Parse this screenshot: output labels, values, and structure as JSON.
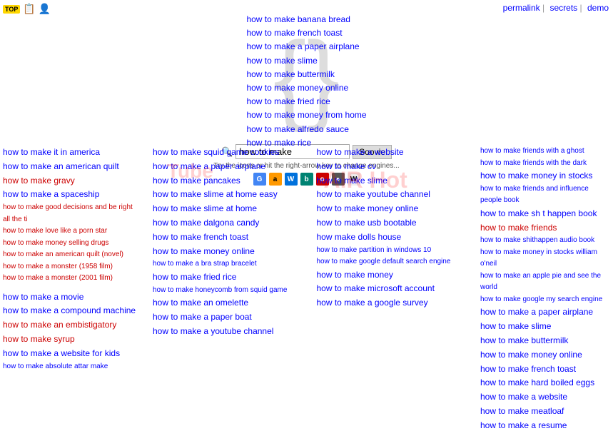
{
  "topbar": {
    "star_label": "TOP",
    "permalink": "permalink",
    "separator": "|",
    "secrets": "secrets",
    "demo": "demo"
  },
  "search": {
    "input_value": "how to make",
    "button_label": "Sooviе",
    "hint": "Try the icons or hit the right-arrow key to change engines...",
    "engines": [
      "G",
      "a",
      "W",
      "b",
      "o",
      "●",
      "W"
    ]
  },
  "center_links": [
    "how to make banana bread",
    "how to make french toast",
    "how to make a paper airplane",
    "how to make slime",
    "how to make buttermilk",
    "how to make money online",
    "how to make fried rice",
    "how to make money from home",
    "how to make alfredo sauce",
    "how to make rice"
  ],
  "col1": {
    "links": [
      {
        "text": "how to make it in america",
        "style": "blue"
      },
      {
        "text": "how to make an american quilt",
        "style": "blue"
      },
      {
        "text": "how to make gravy",
        "style": "red"
      },
      {
        "text": "how to make a spaceship",
        "style": "blue"
      },
      {
        "text": "how to make good decisions and be right all the ti",
        "style": "red small"
      },
      {
        "text": "how to make love like a porn star",
        "style": "red small"
      },
      {
        "text": "how to make money selling drugs",
        "style": "red small"
      },
      {
        "text": "how to make an american quilt (novel)",
        "style": "red small"
      },
      {
        "text": "how to make a monster (1958 film)",
        "style": "red small"
      },
      {
        "text": "how to make a monster (2001 film)",
        "style": "red small"
      },
      {
        "text": "",
        "style": "spacer"
      },
      {
        "text": "how to make a movie",
        "style": "blue"
      },
      {
        "text": "how to make a compound machine",
        "style": "blue"
      },
      {
        "text": "how to make an embistigatory",
        "style": "red"
      },
      {
        "text": "how to make syrup",
        "style": "red"
      },
      {
        "text": "how to make a website for kids",
        "style": "blue"
      },
      {
        "text": "how to make absolute attar make",
        "style": "blue small"
      }
    ]
  },
  "col2": {
    "links": [
      {
        "text": "how to make squid game cookies",
        "style": "blue"
      },
      {
        "text": "how to make a paper airplane",
        "style": "blue"
      },
      {
        "text": "how to make pancakes",
        "style": "blue"
      },
      {
        "text": "how to make slime at home easy",
        "style": "blue"
      },
      {
        "text": "how to make slime at home",
        "style": "blue"
      },
      {
        "text": "how to make dalgona candy",
        "style": "blue"
      },
      {
        "text": "how to make french toast",
        "style": "blue"
      },
      {
        "text": "how to make money online",
        "style": "blue"
      },
      {
        "text": "how to make a bra strap bracelet",
        "style": "blue small"
      },
      {
        "text": "how to make fried rice",
        "style": "blue"
      },
      {
        "text": "how to make honeycomb from squid game",
        "style": "blue small"
      },
      {
        "text": "how to make an omelette",
        "style": "blue"
      },
      {
        "text": "how to make a paper boat",
        "style": "blue"
      },
      {
        "text": "how to make a youtube channel",
        "style": "blue"
      }
    ],
    "watermark": "Tube"
  },
  "col3": {
    "links": [
      {
        "text": "how to make a website",
        "style": "blue"
      },
      {
        "text": "how to make cv",
        "style": "blue"
      },
      {
        "text": "how to make slime",
        "style": "blue"
      },
      {
        "text": "how to make youtube channel",
        "style": "blue"
      },
      {
        "text": "how to make money online",
        "style": "blue"
      },
      {
        "text": "how to make usb bootable",
        "style": "blue"
      },
      {
        "text": "how make dolls house",
        "style": "blue"
      },
      {
        "text": "how to make partition in windows 10",
        "style": "blue small"
      },
      {
        "text": "how to make google default search engine",
        "style": "blue small"
      },
      {
        "text": "how to make money",
        "style": "blue"
      },
      {
        "text": "how to make microsoft account",
        "style": "blue"
      },
      {
        "text": "how to make a google survey",
        "style": "blue"
      }
    ],
    "watermark": "AIR Hot"
  },
  "col4": {
    "links": [
      {
        "text": "how to make friends with a ghost",
        "style": "blue small"
      },
      {
        "text": "how to make friends with the dark",
        "style": "blue small"
      },
      {
        "text": "how to make money in stocks",
        "style": "blue"
      },
      {
        "text": "how to make friends and influence people book",
        "style": "blue small"
      },
      {
        "text": "how to make sh t happen book",
        "style": "blue"
      },
      {
        "text": "how to make friends",
        "style": "red"
      },
      {
        "text": "how to make shithappen audio book",
        "style": "blue small"
      },
      {
        "text": "how to make money in stocks william o'neil",
        "style": "blue small"
      },
      {
        "text": "how to make an apple pie and see the world",
        "style": "blue small"
      },
      {
        "text": "how to make google my search engine",
        "style": "blue small"
      },
      {
        "text": "how to make a paper airplane",
        "style": "blue"
      },
      {
        "text": "how to make slime",
        "style": "blue"
      },
      {
        "text": "how to make buttermilk",
        "style": "blue"
      },
      {
        "text": "how to make money online",
        "style": "blue"
      },
      {
        "text": "how to make french toast",
        "style": "blue"
      },
      {
        "text": "how to make hard boiled eggs",
        "style": "blue"
      },
      {
        "text": "how to make a website",
        "style": "blue"
      },
      {
        "text": "how to make meatloaf",
        "style": "blue"
      },
      {
        "text": "how to make a resume",
        "style": "blue"
      }
    ]
  }
}
